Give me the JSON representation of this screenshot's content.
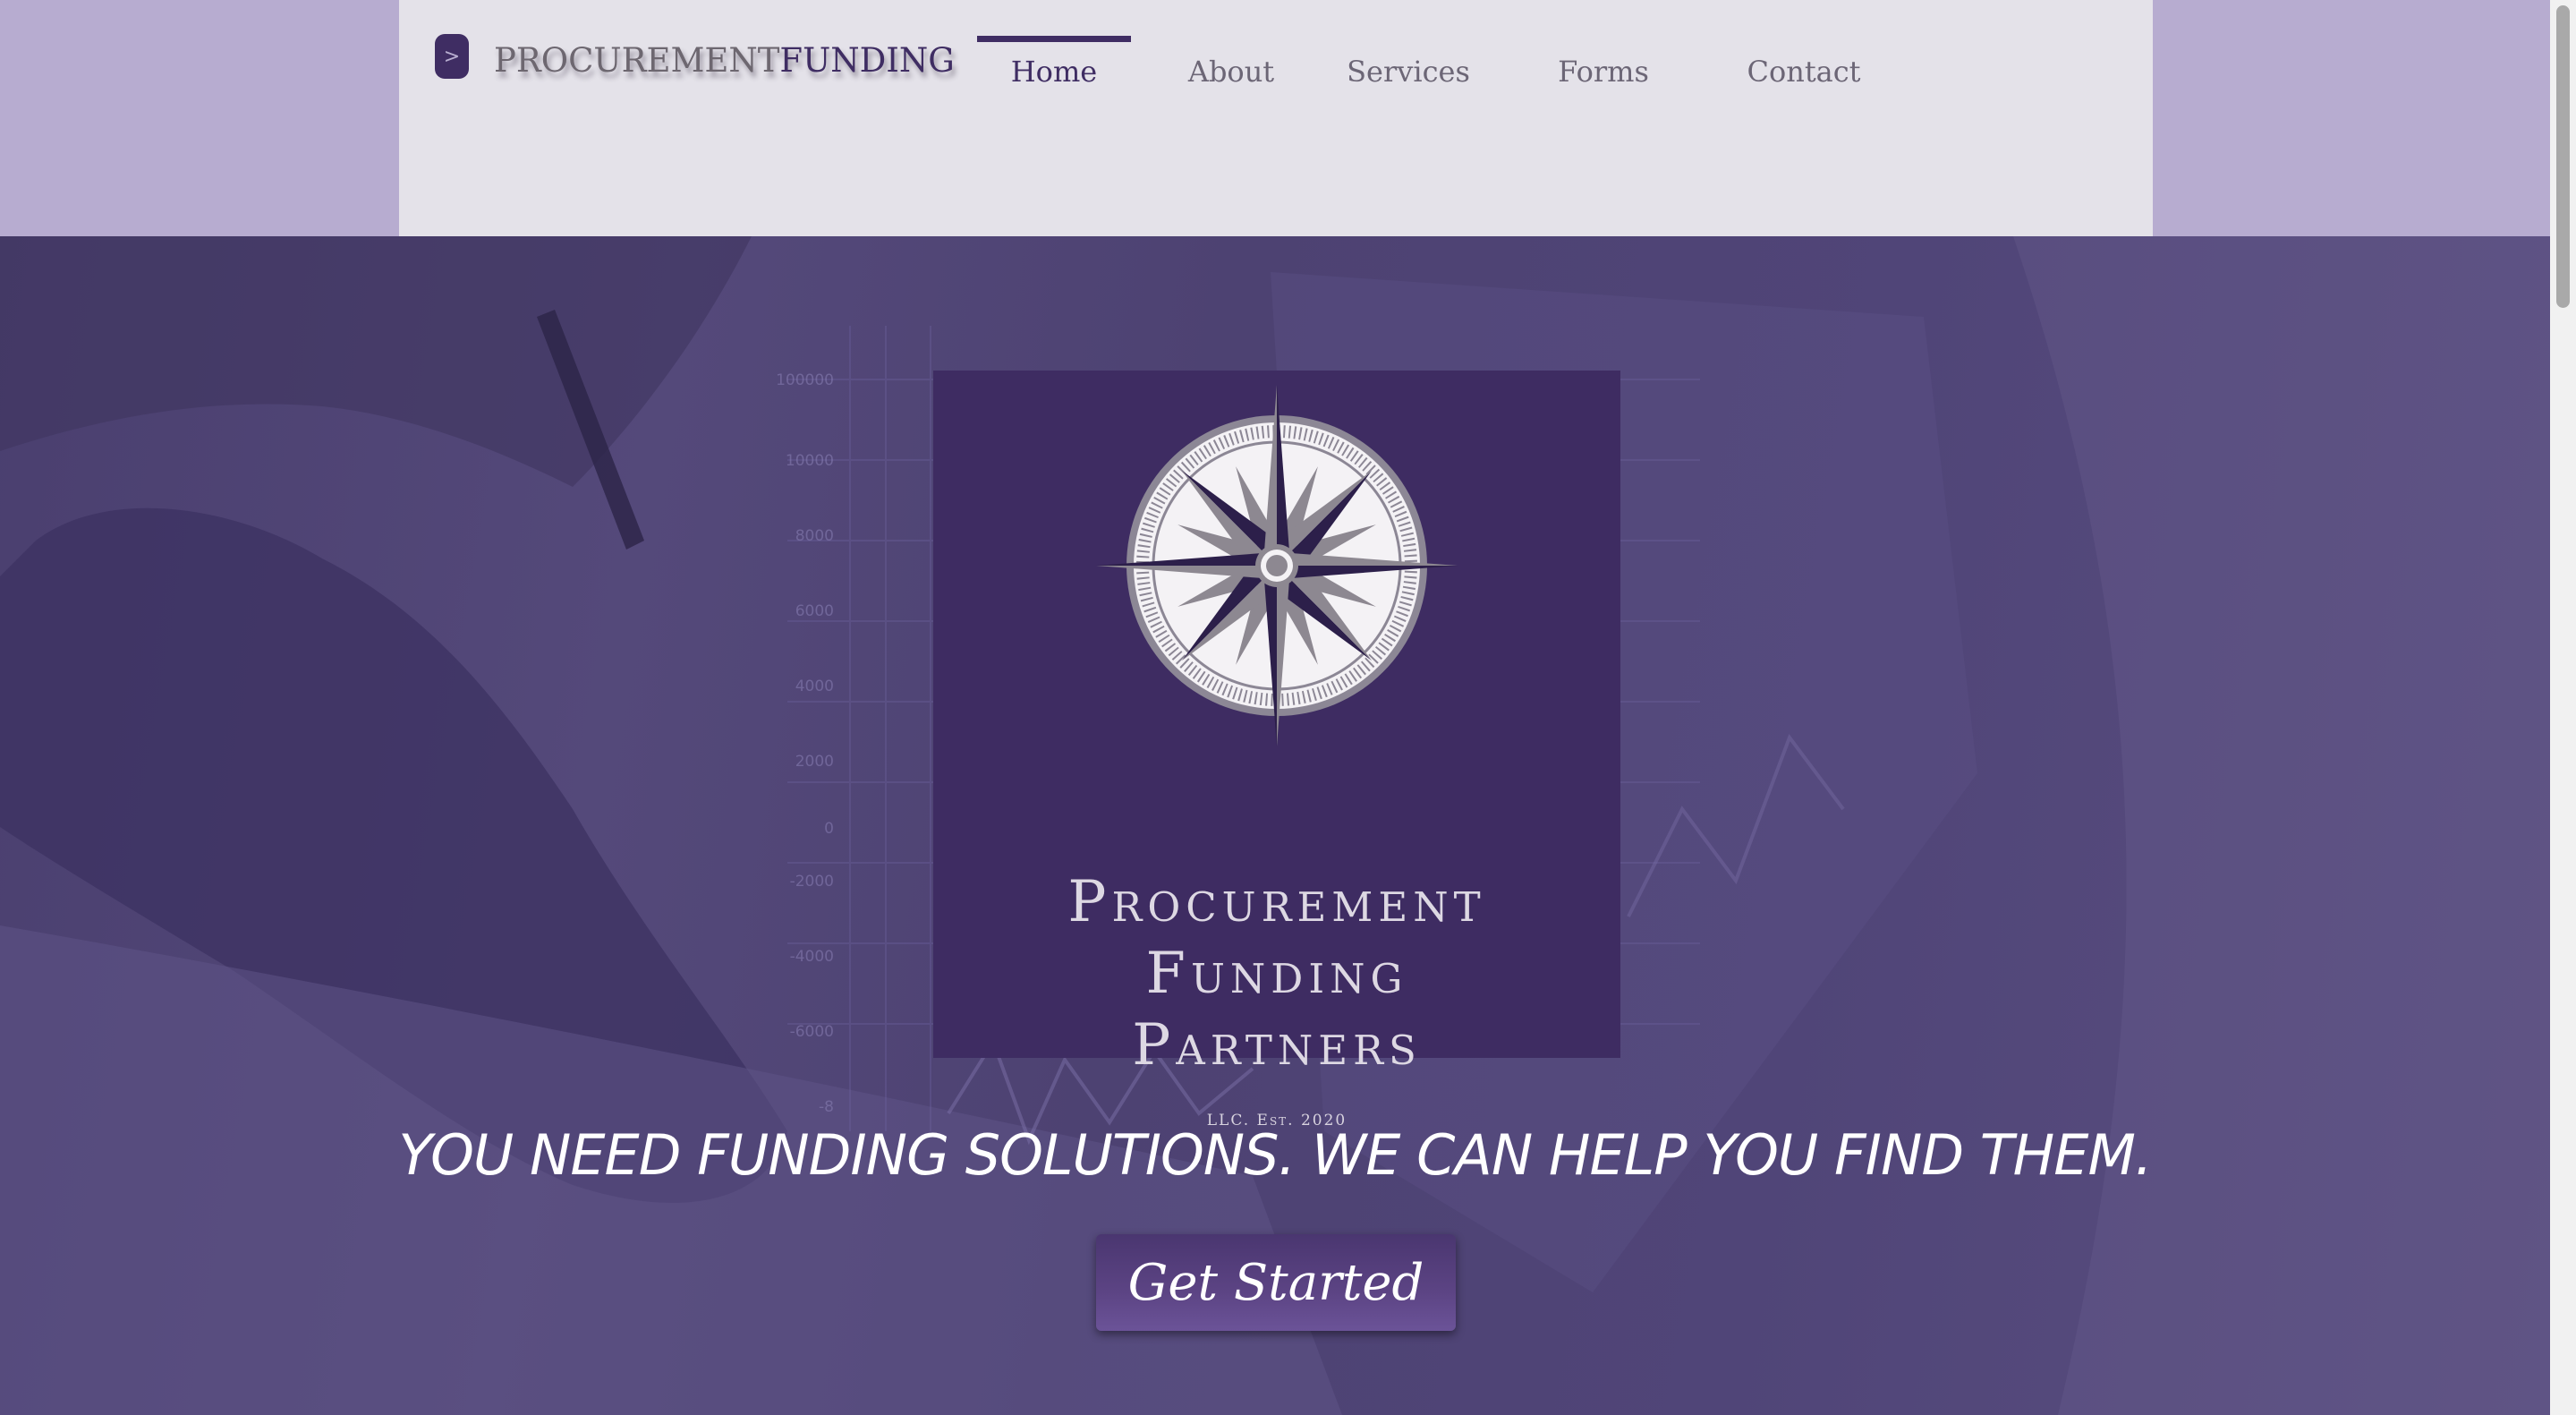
{
  "colors": {
    "brand_purple": "#3f2d63",
    "page_lavender": "#b7acd0",
    "header_bg": "#e4e2e9",
    "hero_overlay": "#4f4476"
  },
  "header": {
    "logo_icon": "chevron-right-icon",
    "logo_icon_glyph": ">",
    "logo_text_part1": "PROCUREMENT",
    "logo_text_part2": "FUNDING"
  },
  "nav": {
    "items": [
      {
        "label": "Home",
        "active": true
      },
      {
        "label": "About",
        "active": false
      },
      {
        "label": "Services",
        "active": false
      },
      {
        "label": "Forms",
        "active": false
      },
      {
        "label": "Contact",
        "active": false
      }
    ]
  },
  "hero": {
    "card": {
      "emblem": "compass-rose-icon",
      "title_line1": "Procurement",
      "title_line2": "Funding",
      "title_line3": "Partners",
      "subtitle": "LLC. Est. 2020"
    },
    "tagline": "YOU NEED FUNDING SOLUTIONS. WE CAN HELP YOU FIND THEM.",
    "cta_label": "Get Started",
    "background_chart_labels": [
      "100000",
      "10000",
      "8000",
      "6000",
      "4000",
      "2000",
      "0",
      "-2000",
      "-4000",
      "-6000",
      "-8"
    ]
  }
}
